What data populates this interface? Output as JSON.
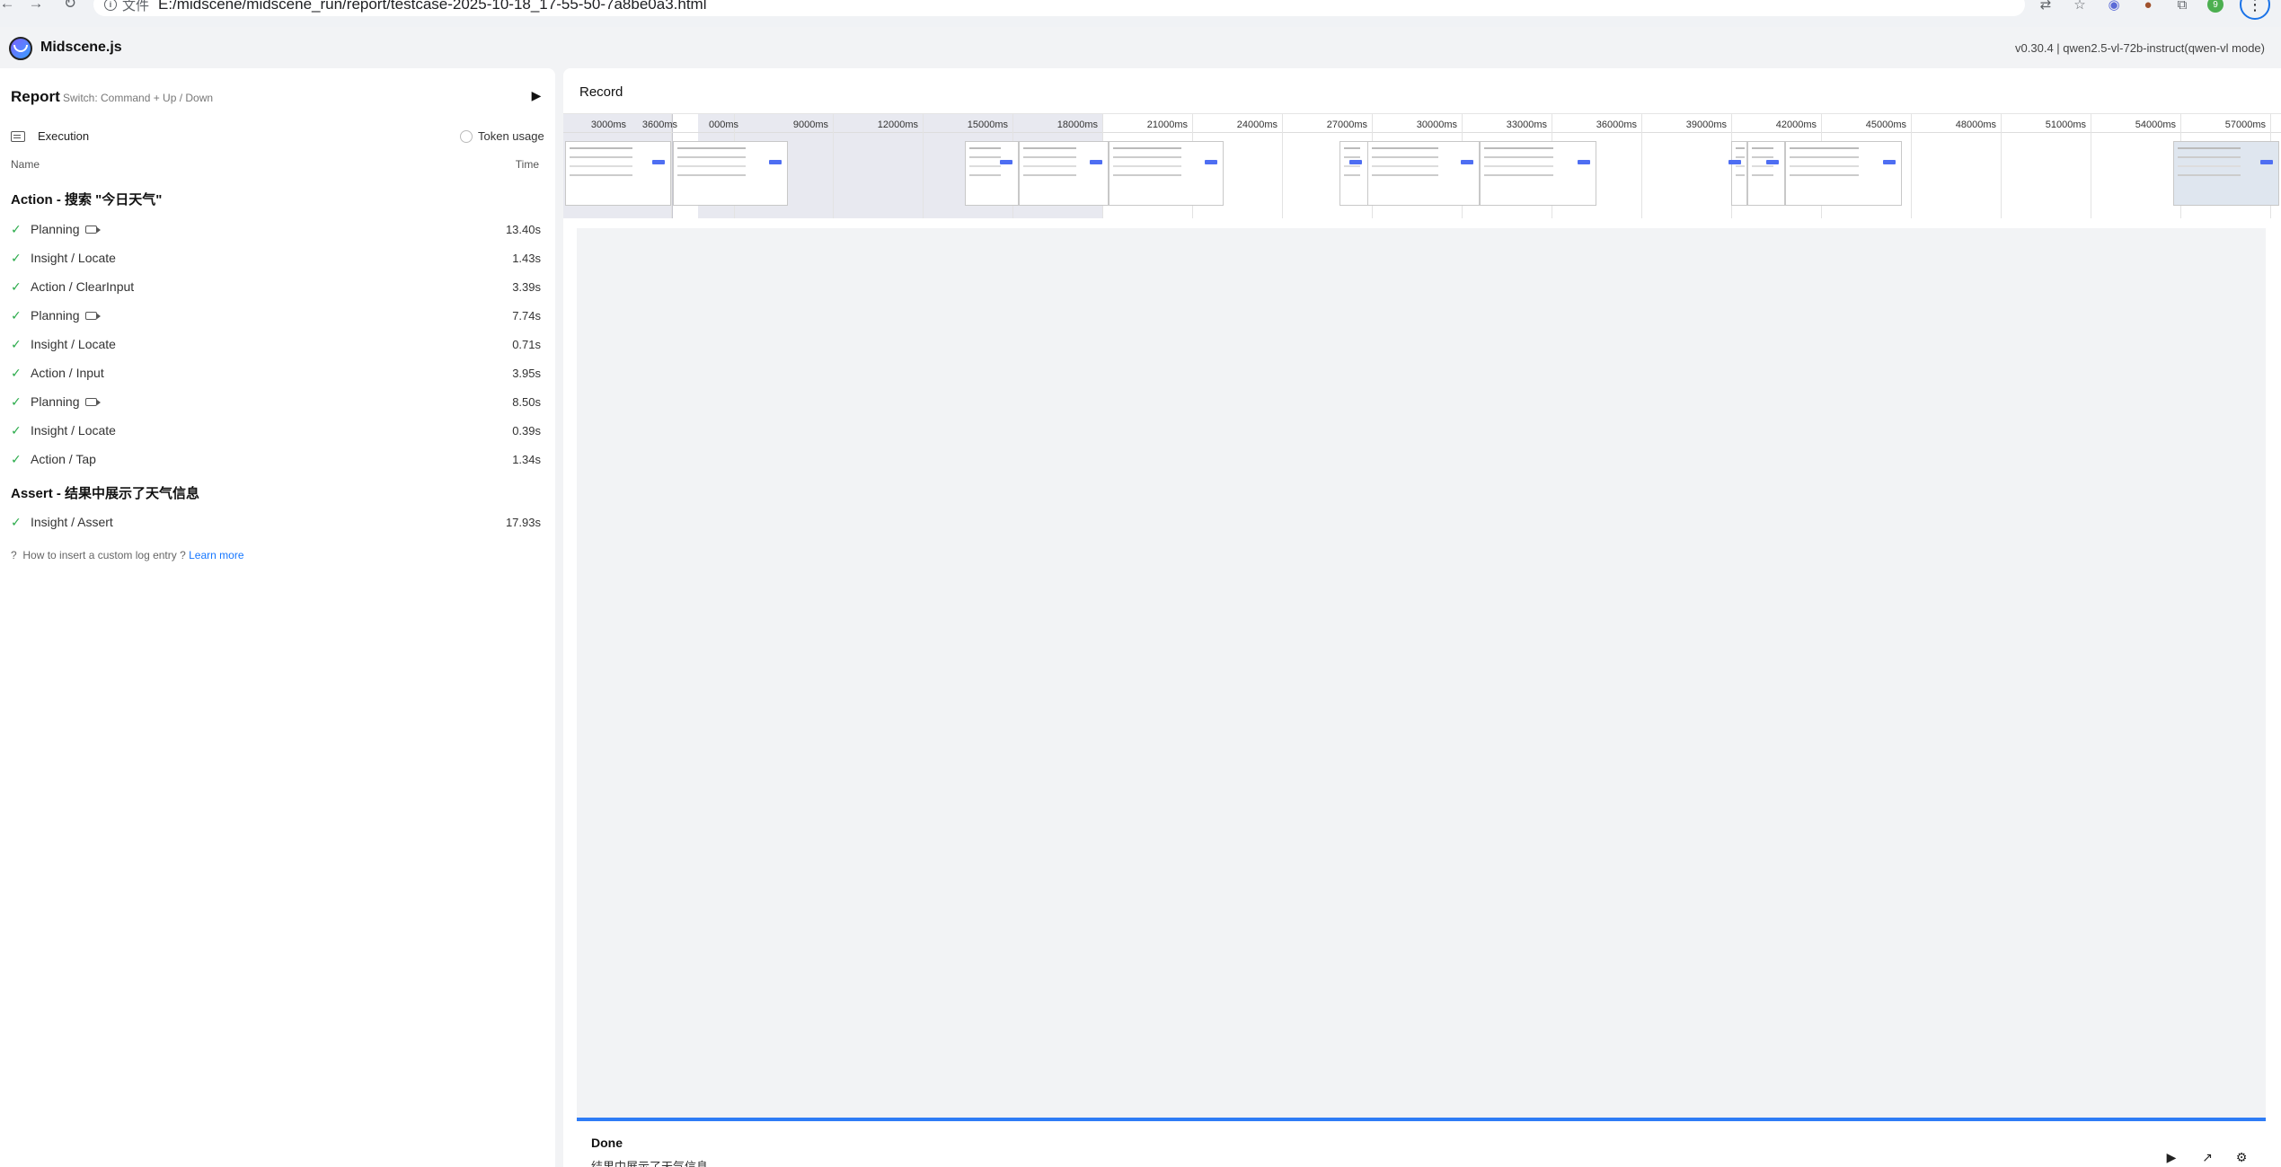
{
  "browser": {
    "file_label": "文件",
    "url": "E:/midscene/midscene_run/report/testcase-2025-10-18_17-55-50-7a8be0a3.html",
    "profile_initial": "9"
  },
  "header": {
    "brand": "Midscene.js",
    "version": "v0.30.4 | qwen2.5-vl-72b-instruct(qwen-vl mode)"
  },
  "sidebar": {
    "title": "Report",
    "switch_hint": "Switch: Command + Up / Down",
    "execution_label": "Execution",
    "token_usage_label": "Token usage",
    "col_name": "Name",
    "col_time": "Time",
    "sections": [
      {
        "title": "Action - 搜索 \"今日天气\"",
        "tasks": [
          {
            "name": "Planning",
            "time": "13.40s",
            "has_recording": true
          },
          {
            "name": "Insight / Locate",
            "time": "1.43s",
            "has_recording": false
          },
          {
            "name": "Action / ClearInput",
            "time": "3.39s",
            "has_recording": false
          },
          {
            "name": "Planning",
            "time": "7.74s",
            "has_recording": true
          },
          {
            "name": "Insight / Locate",
            "time": "0.71s",
            "has_recording": false
          },
          {
            "name": "Action / Input",
            "time": "3.95s",
            "has_recording": false
          },
          {
            "name": "Planning",
            "time": "8.50s",
            "has_recording": true
          },
          {
            "name": "Insight / Locate",
            "time": "0.39s",
            "has_recording": false
          },
          {
            "name": "Action / Tap",
            "time": "1.34s",
            "has_recording": false
          }
        ]
      },
      {
        "title": "Assert - 结果中展示了天气信息",
        "tasks": [
          {
            "name": "Insight / Assert",
            "time": "17.93s",
            "has_recording": false
          }
        ]
      }
    ],
    "help_text": "How to insert a custom log entry ?",
    "help_link": "Learn more"
  },
  "main": {
    "record_title": "Record",
    "timeline_ticks": [
      "3000ms",
      "3600ms",
      "000ms",
      "9000ms",
      "12000ms",
      "15000ms",
      "18000ms",
      "21000ms",
      "24000ms",
      "27000ms",
      "30000ms",
      "33000ms",
      "36000ms",
      "39000ms",
      "42000ms",
      "45000ms",
      "48000ms",
      "51000ms",
      "54000ms",
      "57000ms"
    ],
    "status": "Done",
    "status_sub": "结果中展示了天气信息"
  },
  "colors": {
    "success": "#2bab4b",
    "accent": "#2e7cf6",
    "link": "#1677ff"
  }
}
